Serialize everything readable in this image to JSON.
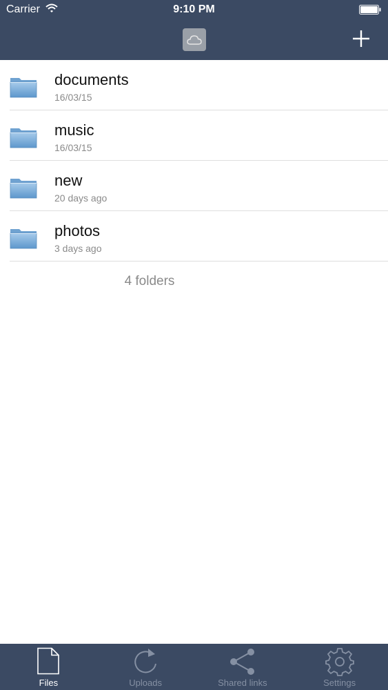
{
  "status": {
    "carrier": "Carrier",
    "time": "9:10 PM"
  },
  "header": {
    "cloud_icon": "cloud-icon",
    "add_icon": "plus-icon"
  },
  "folders": [
    {
      "name": "documents",
      "date": "16/03/15"
    },
    {
      "name": "music",
      "date": "16/03/15"
    },
    {
      "name": "new",
      "date": "20 days ago"
    },
    {
      "name": "photos",
      "date": "3 days ago"
    }
  ],
  "folder_count": "4 folders",
  "tabs": [
    {
      "label": "Files",
      "icon": "file-icon",
      "active": true
    },
    {
      "label": "Uploads",
      "icon": "refresh-icon",
      "active": false
    },
    {
      "label": "Shared links",
      "icon": "share-icon",
      "active": false
    },
    {
      "label": "Settings",
      "icon": "gear-icon",
      "active": false
    }
  ],
  "colors": {
    "bar": "#3b4a63",
    "folder_blue": "#7fb0dc",
    "inactive_tab": "#8590a3"
  }
}
